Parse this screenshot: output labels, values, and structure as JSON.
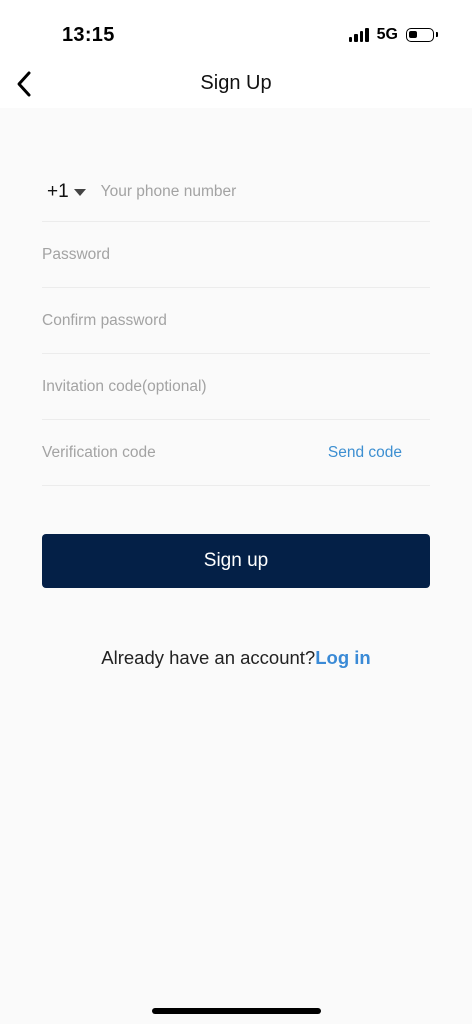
{
  "status_bar": {
    "time": "13:15",
    "network": "5G",
    "icons": [
      "signal-icon",
      "battery-icon"
    ]
  },
  "nav": {
    "title": "Sign Up",
    "back_icon": "chevron-left-icon"
  },
  "form": {
    "country_code": "+1",
    "phone_placeholder": "Your phone number",
    "password_placeholder": "Password",
    "confirm_password_placeholder": "Confirm password",
    "invitation_placeholder": "Invitation code(optional)",
    "verification_placeholder": "Verification code",
    "send_code_label": "Send code"
  },
  "actions": {
    "signup_label": "Sign up",
    "login_prompt": "Already have an account?",
    "login_label": "Log in"
  },
  "colors": {
    "primary_button": "#042047",
    "link": "#3a8ad6",
    "send_code": "#3d8fd1",
    "background": "#fafafa"
  }
}
